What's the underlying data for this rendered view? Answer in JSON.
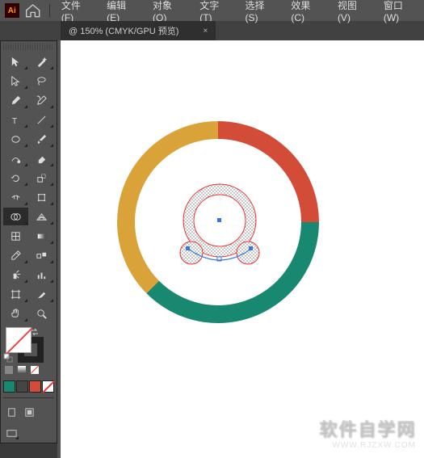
{
  "app": {
    "logo_text": "Ai"
  },
  "menu": {
    "file": "文件(F)",
    "edit": "编辑(E)",
    "object": "对象(O)",
    "type": "文字(T)",
    "select": "选择(S)",
    "effect": "效果(C)",
    "view": "视图(V)",
    "window": "窗口(W)"
  },
  "doc_tab": {
    "title": "@ 150% (CMYK/GPU 预览)",
    "close": "×"
  },
  "colors": {
    "ring_yellow": "#d9a33a",
    "ring_red": "#d24c37",
    "ring_teal": "#188970"
  },
  "swatches": [
    "#188970",
    "#454545",
    "#d24c37",
    "#ffffff"
  ],
  "watermark": {
    "big": "软件自学网",
    "url": "WWW.RJZXW.COM"
  }
}
